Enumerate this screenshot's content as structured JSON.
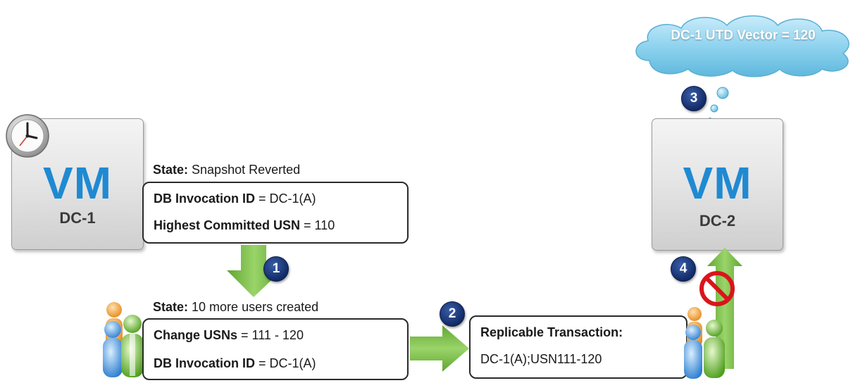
{
  "cloud": {
    "text": "DC-1 UTD Vector = 120"
  },
  "vm_left": {
    "label": "VM",
    "name": "DC-1"
  },
  "vm_right": {
    "label": "VM",
    "name": "DC-2"
  },
  "state_top": {
    "label": "State:",
    "value": "Snapshot Reverted"
  },
  "box_top": {
    "line1_label": "DB Invocation ID",
    "line1_value": "= DC-1(A)",
    "line2_label": "Highest Committed USN",
    "line2_value": "= 110"
  },
  "state_bottom": {
    "label": "State:",
    "value": "10 more users created"
  },
  "box_bottom": {
    "line1_label": "Change USNs",
    "line1_value": "= 111 - 120",
    "line2_label": "DB Invocation ID",
    "line2_value": "= DC-1(A)"
  },
  "box_replicable": {
    "title": "Replicable Transaction:",
    "value": "DC-1(A);USN111-120"
  },
  "badges": [
    "1",
    "2",
    "3",
    "4"
  ],
  "icons": [
    "clock-icon",
    "users-icon",
    "no-entry-icon",
    "cloud-shape",
    "thought-bubble-icon",
    "arrow-down-icon",
    "arrow-right-icon",
    "arrow-up-icon"
  ],
  "colors": {
    "vm_text": "#1f8ad2",
    "cloud": "#8fd3ef",
    "arrow": "#7ec04a",
    "badge": "#122a66",
    "no_entry": "#d9151b"
  }
}
